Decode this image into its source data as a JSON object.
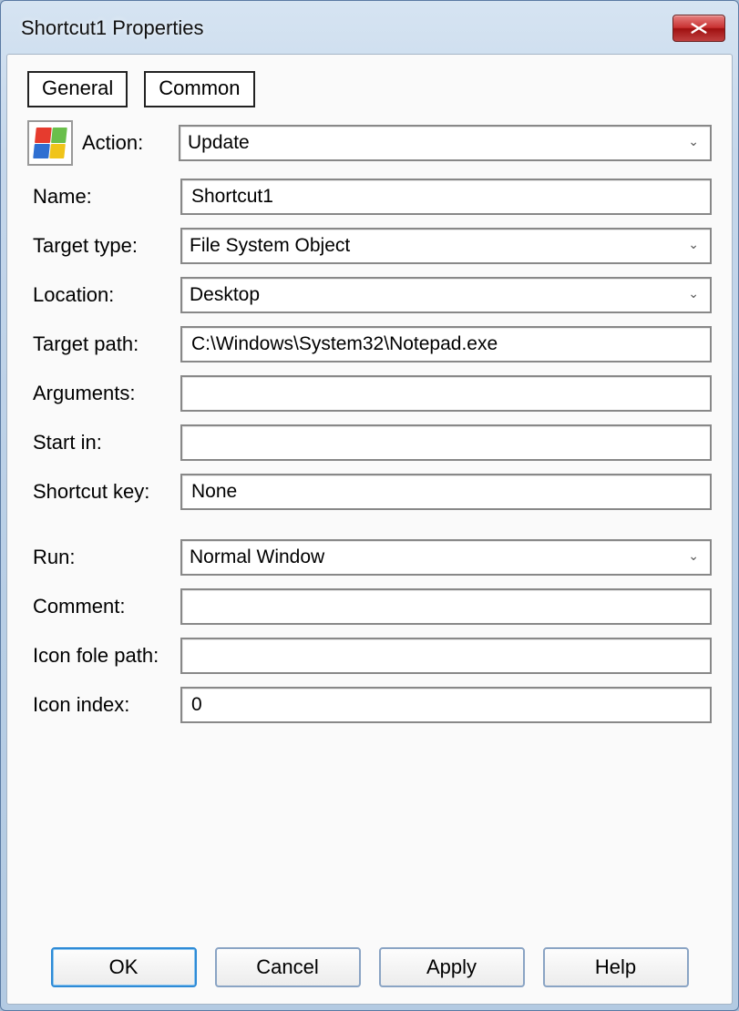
{
  "window": {
    "title": "Shortcut1 Properties"
  },
  "tabs": {
    "general": "General",
    "common": "Common"
  },
  "labels": {
    "action": "Action:",
    "name": "Name:",
    "target_type": "Target type:",
    "location": "Location:",
    "target_path": "Target path:",
    "arguments": "Arguments:",
    "start_in": "Start in:",
    "shortcut_key": "Shortcut key:",
    "run": "Run:",
    "comment": "Comment:",
    "icon_file_path": "Icon fole path:",
    "icon_index": "Icon index:"
  },
  "values": {
    "action": "Update",
    "name": "Shortcut1",
    "target_type": "File System Object",
    "location": "Desktop",
    "target_path": "C:\\Windows\\System32\\Notepad.exe",
    "arguments": "",
    "start_in": "",
    "shortcut_key": "None",
    "run": "Normal Window",
    "comment": "",
    "icon_file_path": "",
    "icon_index": "0"
  },
  "buttons": {
    "ok": "OK",
    "cancel": "Cancel",
    "apply": "Apply",
    "help": "Help"
  }
}
